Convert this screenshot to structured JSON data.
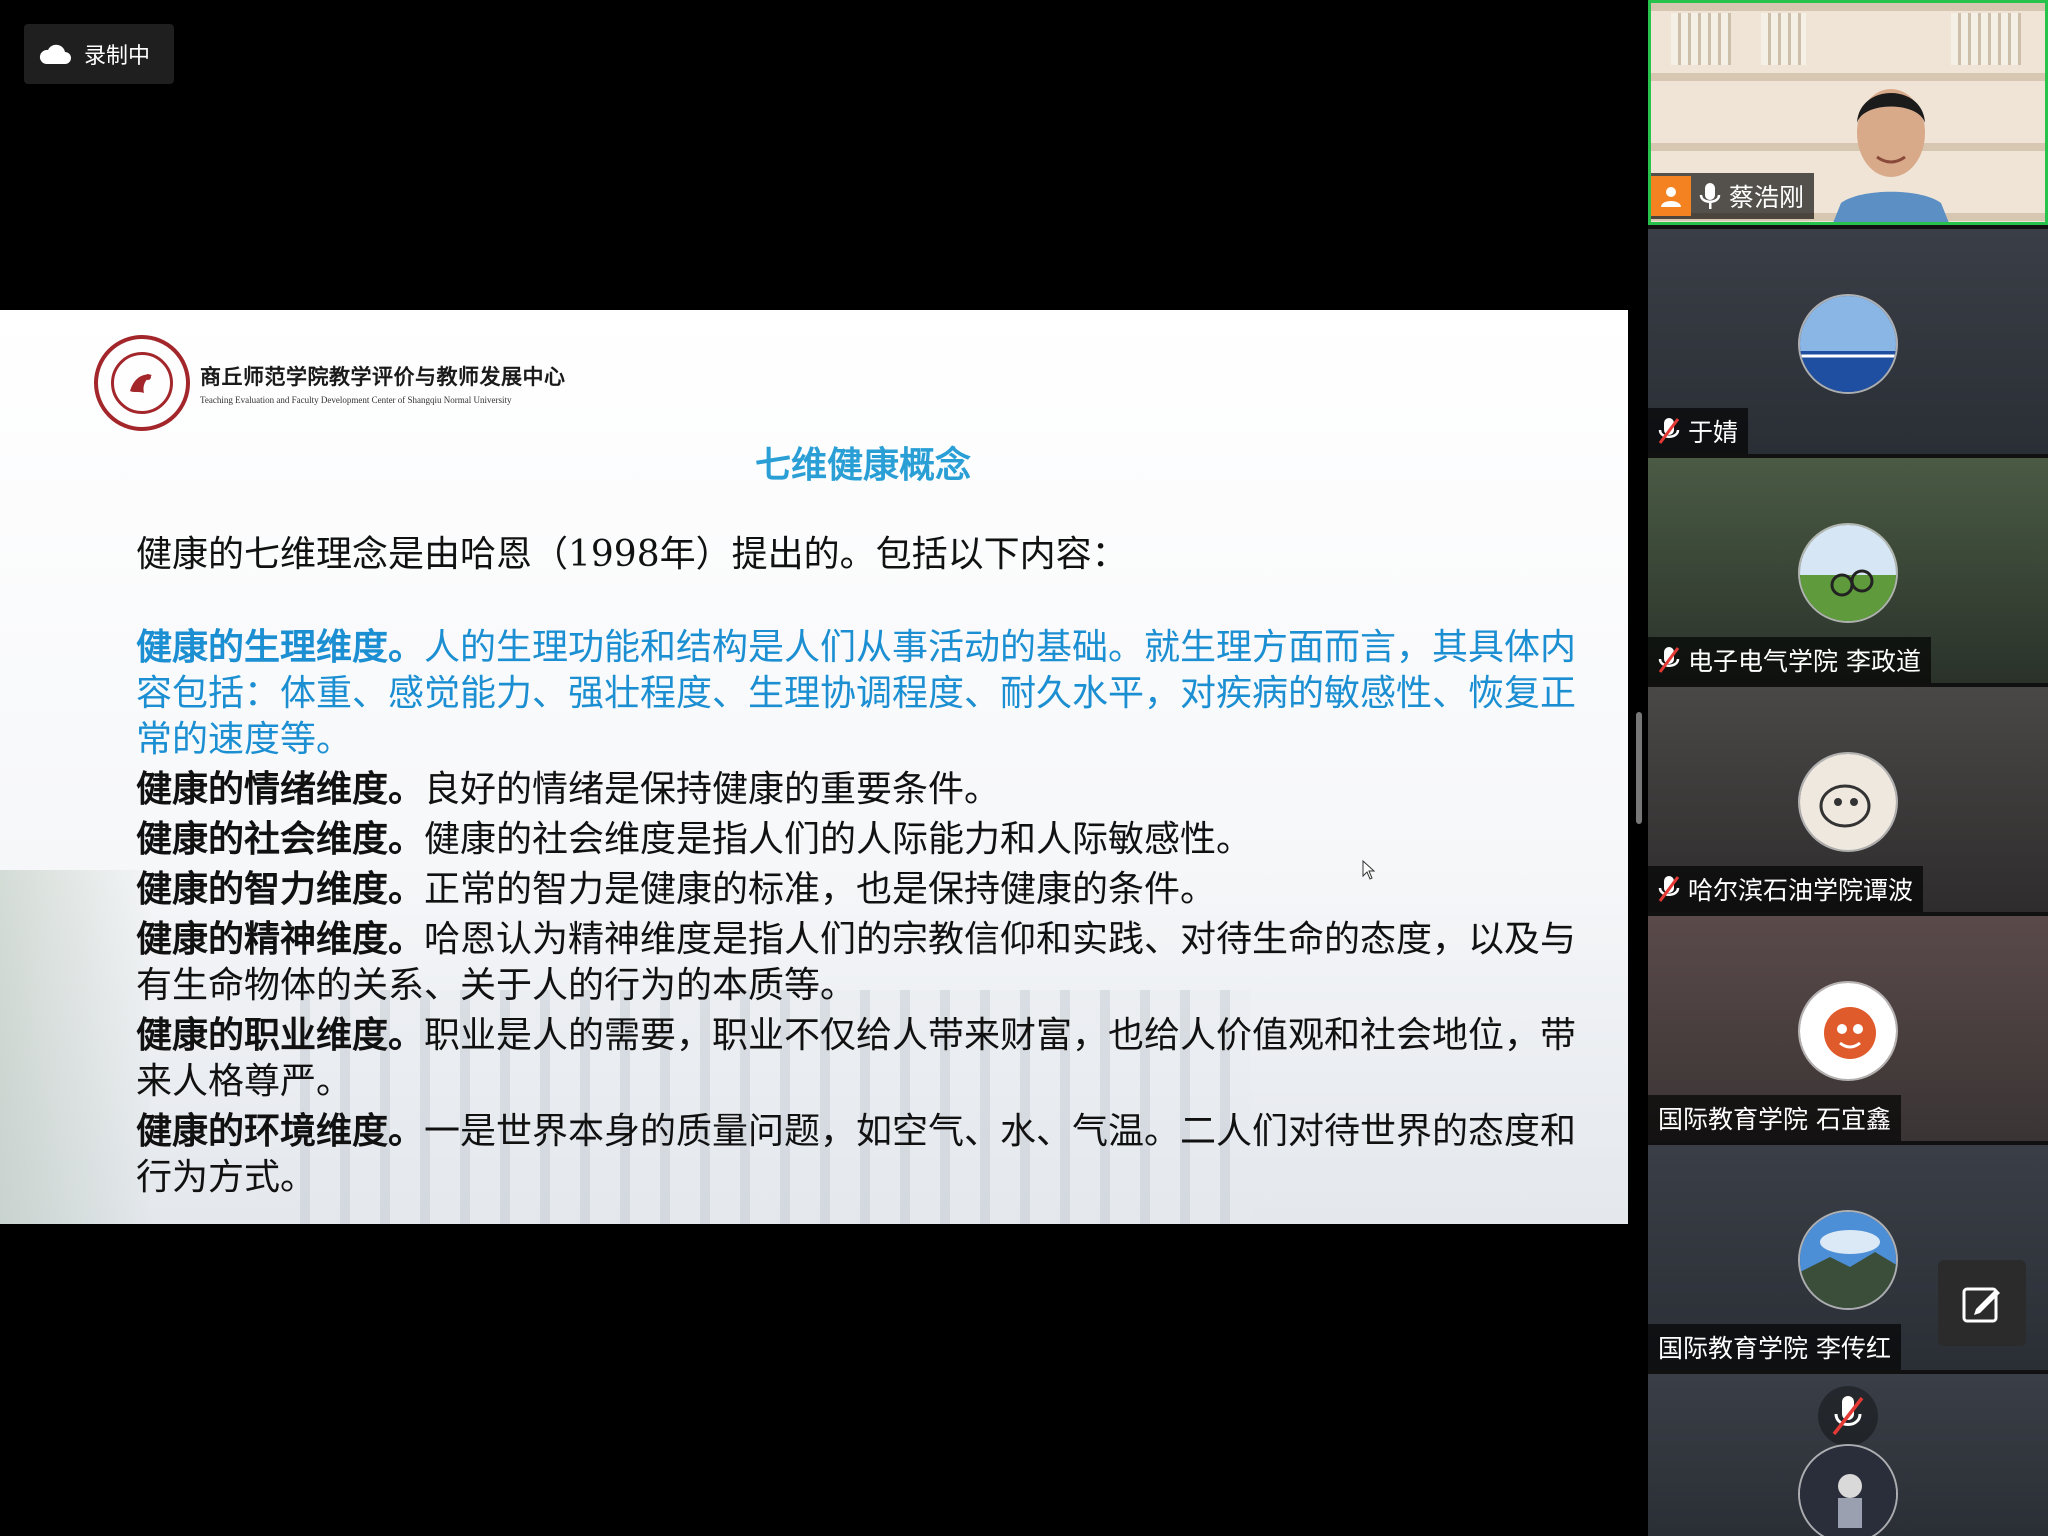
{
  "recording": {
    "label": "录制中"
  },
  "slide": {
    "logo_cn": "商丘师范学院教学评价与教师发展中心",
    "logo_en": "Teaching Evaluation and Faculty Development Center of Shangqiu Normal University",
    "title": "七维健康概念",
    "intro": "健康的七维理念是由哈恩（1998年）提出的。包括以下内容：",
    "paragraphs": [
      {
        "head": "健康的生理维度。",
        "text": "人的生理功能和结构是人们从事活动的基础。就生理方面而言，其具体内容包括：体重、感觉能力、强壮程度、生理协调程度、耐久水平，对疾病的敏感性、恢复正常的速度等。"
      },
      {
        "head": "健康的情绪维度。",
        "text": "良好的情绪是保持健康的重要条件。"
      },
      {
        "head": "健康的社会维度。",
        "text": "健康的社会维度是指人们的人际能力和人际敏感性。"
      },
      {
        "head": "健康的智力维度。",
        "text": "正常的智力是健康的标准，也是保持健康的条件。"
      },
      {
        "head": "健康的精神维度。",
        "text": "哈恩认为精神维度是指人们的宗教信仰和实践、对待生命的态度，以及与有生命物体的关系、关于人的行为的本质等。"
      },
      {
        "head": "健康的职业维度。",
        "text": "职业是人的需要，职业不仅给人带来财富，也给人价值观和社会地位，带来人格尊严。"
      },
      {
        "head": "健康的环境维度。",
        "text": "一是世界本身的质量问题，如空气、水、气温。二人们对待世界的态度和行为方式。"
      }
    ]
  },
  "participants": [
    {
      "name": "蔡浩刚",
      "mic": "on",
      "active": true
    },
    {
      "name": "于婧",
      "mic": "off"
    },
    {
      "name": "电子电气学院 李政道",
      "mic": "off"
    },
    {
      "name": "哈尔滨石油学院谭波",
      "mic": "off"
    },
    {
      "name": "国际教育学院  石宜鑫",
      "mic": "none"
    },
    {
      "name": "国际教育学院 李传红",
      "mic": "none"
    }
  ],
  "colors": {
    "accent": "#1b8fd2",
    "title": "#2a9fd6",
    "active_border": "#27c24c",
    "seal": "#a3262b"
  }
}
